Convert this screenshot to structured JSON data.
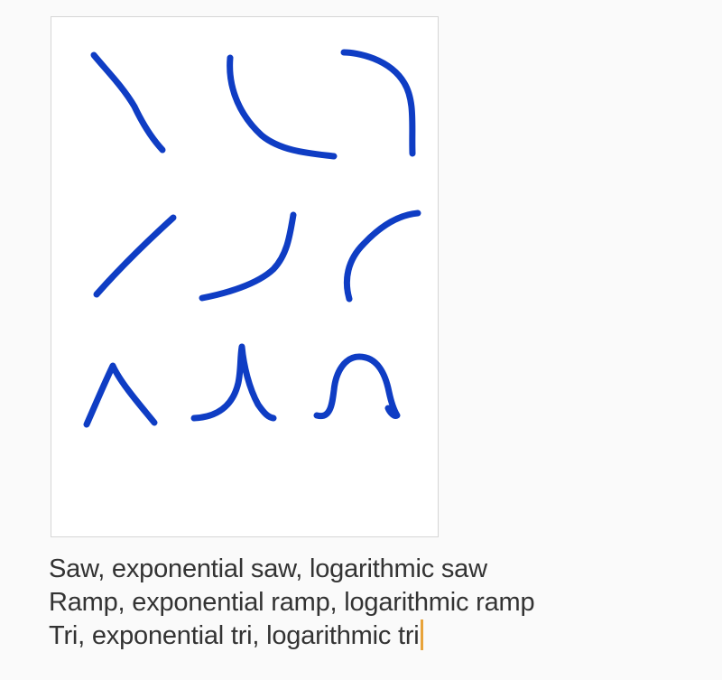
{
  "drawing": {
    "ink_color": "#0f3dc4",
    "strokes": [
      {
        "name": "saw-sketch"
      },
      {
        "name": "exponential-saw-sketch"
      },
      {
        "name": "logarithmic-saw-sketch"
      },
      {
        "name": "ramp-sketch"
      },
      {
        "name": "exponential-ramp-sketch"
      },
      {
        "name": "logarithmic-ramp-sketch"
      },
      {
        "name": "tri-sketch"
      },
      {
        "name": "exponential-tri-sketch"
      },
      {
        "name": "logarithmic-tri-sketch"
      }
    ]
  },
  "note": {
    "lines": [
      "Saw, exponential saw, logarithmic saw",
      "Ramp, exponential ramp, logarithmic ramp",
      "Tri, exponential tri, logarithmic tri"
    ],
    "caret_color": "#e8a33a"
  }
}
